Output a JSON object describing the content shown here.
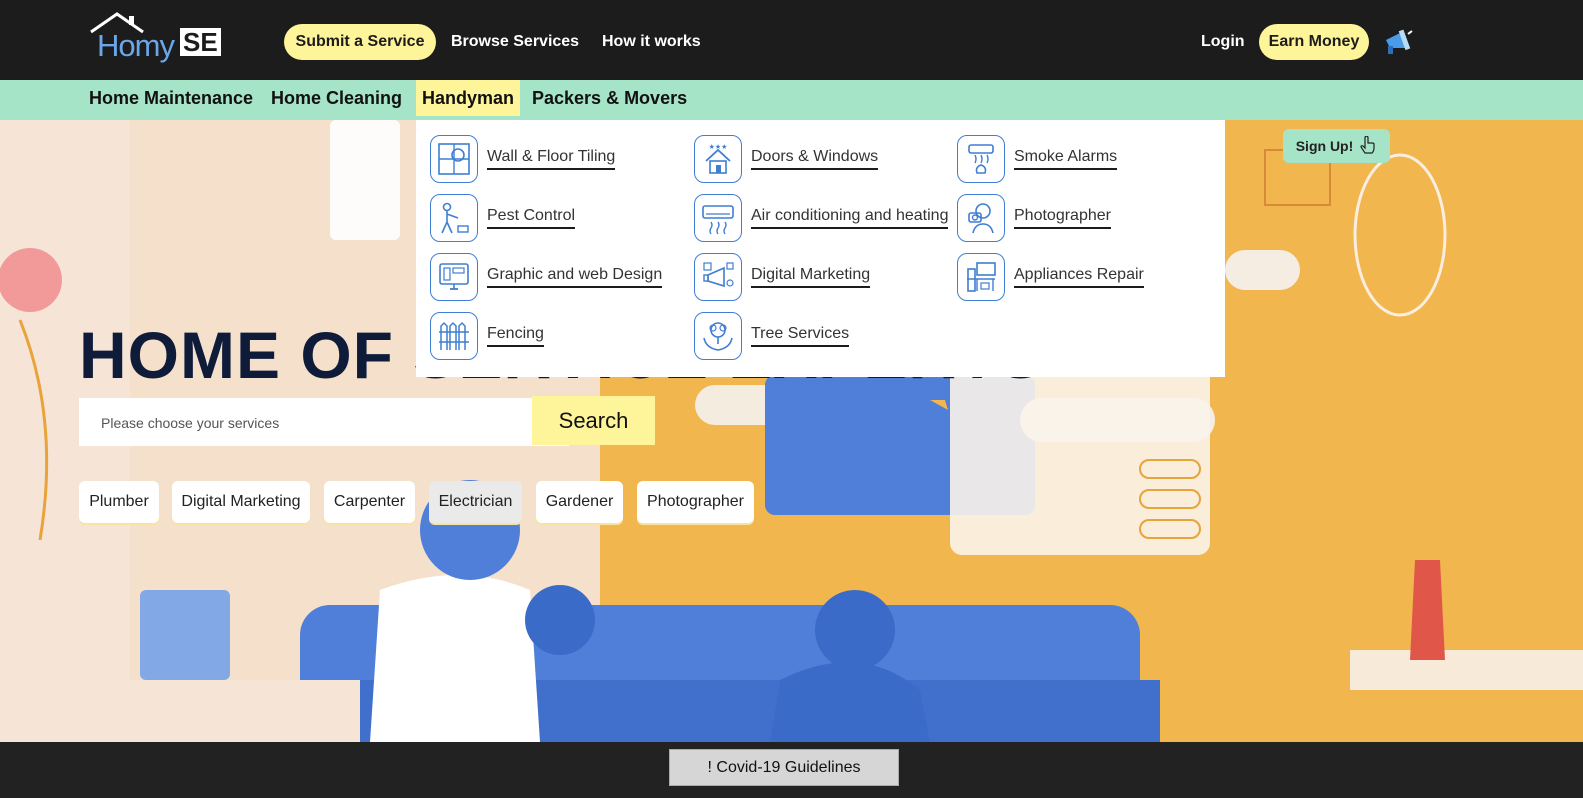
{
  "header": {
    "logo_text_left": "Homy",
    "logo_text_right": "SE",
    "submit_service": "Submit a Service",
    "browse_services": "Browse Services",
    "how_it_works": "How it works",
    "login": "Login",
    "earn_money": "Earn Money",
    "megaphone_icon": "megaphone-icon"
  },
  "categories": [
    {
      "label": "Home Maintenance",
      "active": false
    },
    {
      "label": "Home Cleaning",
      "active": false
    },
    {
      "label": "Handyman",
      "active": true
    },
    {
      "label": "Packers & Movers",
      "active": false
    }
  ],
  "dropdown": {
    "items": [
      {
        "label": "Wall & Floor Tiling",
        "icon": "tiling-icon"
      },
      {
        "label": "Doors & Windows",
        "icon": "house-stars-icon"
      },
      {
        "label": "Smoke Alarms",
        "icon": "smoke-alarm-icon"
      },
      {
        "label": "Pest Control",
        "icon": "pest-control-icon"
      },
      {
        "label": "Air conditioning and heating",
        "icon": "air-conditioner-icon"
      },
      {
        "label": "Photographer",
        "icon": "photographer-icon"
      },
      {
        "label": "Graphic and web Design",
        "icon": "web-design-icon"
      },
      {
        "label": "Digital Marketing",
        "icon": "marketing-icon"
      },
      {
        "label": "Appliances Repair",
        "icon": "appliances-icon"
      },
      {
        "label": "Fencing",
        "icon": "fence-icon"
      },
      {
        "label": "Tree Services",
        "icon": "tree-hands-icon"
      }
    ]
  },
  "hero": {
    "headline": "HOME OF SERVICE EXPERTS",
    "search_placeholder": "Please choose your services",
    "search_button": "Search",
    "chips": [
      "Plumber",
      "Digital Marketing",
      "Carpenter",
      "Electrician",
      "Gardener",
      "Photographer"
    ],
    "signup_label": "Sign Up!"
  },
  "footer": {
    "covid_button": "! Covid-19 Guidelines"
  },
  "colors": {
    "dark": "#1c1c1c",
    "accent_yellow": "#fef49a",
    "mint": "#a5e4c7",
    "hero_orange": "#f2b64e",
    "icon_blue": "#3f7ed2",
    "navy": "#0e1c3a"
  }
}
